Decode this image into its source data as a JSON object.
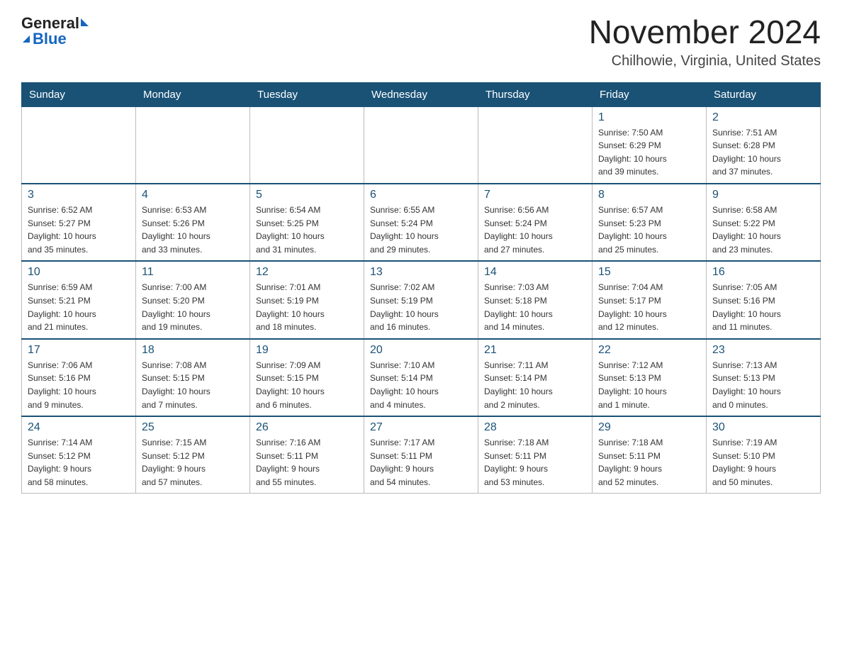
{
  "header": {
    "logo_general": "General",
    "logo_blue": "Blue",
    "month_title": "November 2024",
    "location": "Chilhowie, Virginia, United States"
  },
  "days_of_week": [
    "Sunday",
    "Monday",
    "Tuesday",
    "Wednesday",
    "Thursday",
    "Friday",
    "Saturday"
  ],
  "weeks": [
    {
      "days": [
        {
          "num": "",
          "info": ""
        },
        {
          "num": "",
          "info": ""
        },
        {
          "num": "",
          "info": ""
        },
        {
          "num": "",
          "info": ""
        },
        {
          "num": "",
          "info": ""
        },
        {
          "num": "1",
          "info": "Sunrise: 7:50 AM\nSunset: 6:29 PM\nDaylight: 10 hours\nand 39 minutes."
        },
        {
          "num": "2",
          "info": "Sunrise: 7:51 AM\nSunset: 6:28 PM\nDaylight: 10 hours\nand 37 minutes."
        }
      ]
    },
    {
      "days": [
        {
          "num": "3",
          "info": "Sunrise: 6:52 AM\nSunset: 5:27 PM\nDaylight: 10 hours\nand 35 minutes."
        },
        {
          "num": "4",
          "info": "Sunrise: 6:53 AM\nSunset: 5:26 PM\nDaylight: 10 hours\nand 33 minutes."
        },
        {
          "num": "5",
          "info": "Sunrise: 6:54 AM\nSunset: 5:25 PM\nDaylight: 10 hours\nand 31 minutes."
        },
        {
          "num": "6",
          "info": "Sunrise: 6:55 AM\nSunset: 5:24 PM\nDaylight: 10 hours\nand 29 minutes."
        },
        {
          "num": "7",
          "info": "Sunrise: 6:56 AM\nSunset: 5:24 PM\nDaylight: 10 hours\nand 27 minutes."
        },
        {
          "num": "8",
          "info": "Sunrise: 6:57 AM\nSunset: 5:23 PM\nDaylight: 10 hours\nand 25 minutes."
        },
        {
          "num": "9",
          "info": "Sunrise: 6:58 AM\nSunset: 5:22 PM\nDaylight: 10 hours\nand 23 minutes."
        }
      ]
    },
    {
      "days": [
        {
          "num": "10",
          "info": "Sunrise: 6:59 AM\nSunset: 5:21 PM\nDaylight: 10 hours\nand 21 minutes."
        },
        {
          "num": "11",
          "info": "Sunrise: 7:00 AM\nSunset: 5:20 PM\nDaylight: 10 hours\nand 19 minutes."
        },
        {
          "num": "12",
          "info": "Sunrise: 7:01 AM\nSunset: 5:19 PM\nDaylight: 10 hours\nand 18 minutes."
        },
        {
          "num": "13",
          "info": "Sunrise: 7:02 AM\nSunset: 5:19 PM\nDaylight: 10 hours\nand 16 minutes."
        },
        {
          "num": "14",
          "info": "Sunrise: 7:03 AM\nSunset: 5:18 PM\nDaylight: 10 hours\nand 14 minutes."
        },
        {
          "num": "15",
          "info": "Sunrise: 7:04 AM\nSunset: 5:17 PM\nDaylight: 10 hours\nand 12 minutes."
        },
        {
          "num": "16",
          "info": "Sunrise: 7:05 AM\nSunset: 5:16 PM\nDaylight: 10 hours\nand 11 minutes."
        }
      ]
    },
    {
      "days": [
        {
          "num": "17",
          "info": "Sunrise: 7:06 AM\nSunset: 5:16 PM\nDaylight: 10 hours\nand 9 minutes."
        },
        {
          "num": "18",
          "info": "Sunrise: 7:08 AM\nSunset: 5:15 PM\nDaylight: 10 hours\nand 7 minutes."
        },
        {
          "num": "19",
          "info": "Sunrise: 7:09 AM\nSunset: 5:15 PM\nDaylight: 10 hours\nand 6 minutes."
        },
        {
          "num": "20",
          "info": "Sunrise: 7:10 AM\nSunset: 5:14 PM\nDaylight: 10 hours\nand 4 minutes."
        },
        {
          "num": "21",
          "info": "Sunrise: 7:11 AM\nSunset: 5:14 PM\nDaylight: 10 hours\nand 2 minutes."
        },
        {
          "num": "22",
          "info": "Sunrise: 7:12 AM\nSunset: 5:13 PM\nDaylight: 10 hours\nand 1 minute."
        },
        {
          "num": "23",
          "info": "Sunrise: 7:13 AM\nSunset: 5:13 PM\nDaylight: 10 hours\nand 0 minutes."
        }
      ]
    },
    {
      "days": [
        {
          "num": "24",
          "info": "Sunrise: 7:14 AM\nSunset: 5:12 PM\nDaylight: 9 hours\nand 58 minutes."
        },
        {
          "num": "25",
          "info": "Sunrise: 7:15 AM\nSunset: 5:12 PM\nDaylight: 9 hours\nand 57 minutes."
        },
        {
          "num": "26",
          "info": "Sunrise: 7:16 AM\nSunset: 5:11 PM\nDaylight: 9 hours\nand 55 minutes."
        },
        {
          "num": "27",
          "info": "Sunrise: 7:17 AM\nSunset: 5:11 PM\nDaylight: 9 hours\nand 54 minutes."
        },
        {
          "num": "28",
          "info": "Sunrise: 7:18 AM\nSunset: 5:11 PM\nDaylight: 9 hours\nand 53 minutes."
        },
        {
          "num": "29",
          "info": "Sunrise: 7:18 AM\nSunset: 5:11 PM\nDaylight: 9 hours\nand 52 minutes."
        },
        {
          "num": "30",
          "info": "Sunrise: 7:19 AM\nSunset: 5:10 PM\nDaylight: 9 hours\nand 50 minutes."
        }
      ]
    }
  ]
}
